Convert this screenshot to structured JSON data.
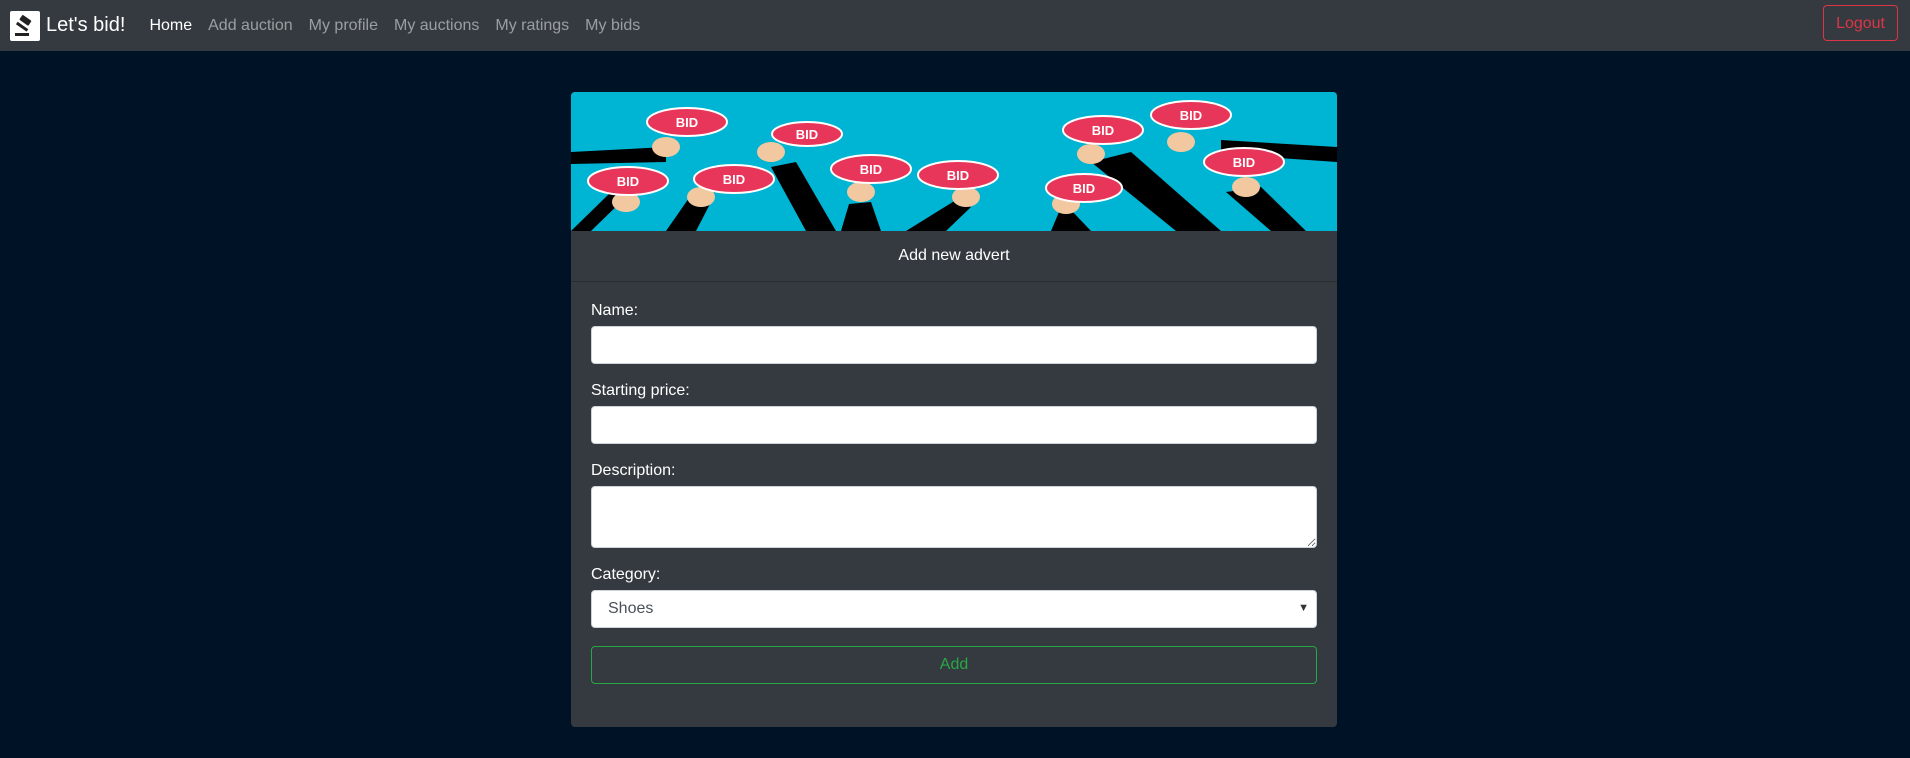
{
  "navbar": {
    "brand": "Let's bid!",
    "links": [
      "Home",
      "Add auction",
      "My profile",
      "My auctions",
      "My ratings",
      "My bids"
    ],
    "logout": "Logout"
  },
  "card": {
    "banner_sign_text": "BID",
    "header": "Add new advert",
    "fields": {
      "name_label": "Name:",
      "price_label": "Starting price:",
      "description_label": "Description:",
      "category_label": "Category:",
      "category_value": "Shoes"
    },
    "submit_label": "Add"
  },
  "colors": {
    "page_bg": "#001226",
    "navbar_bg": "#343a40",
    "card_bg": "#343a40",
    "banner_bg": "#00b5d3",
    "danger": "#dc3545",
    "success": "#28a745"
  },
  "icons": {
    "brand": "gavel-icon"
  }
}
